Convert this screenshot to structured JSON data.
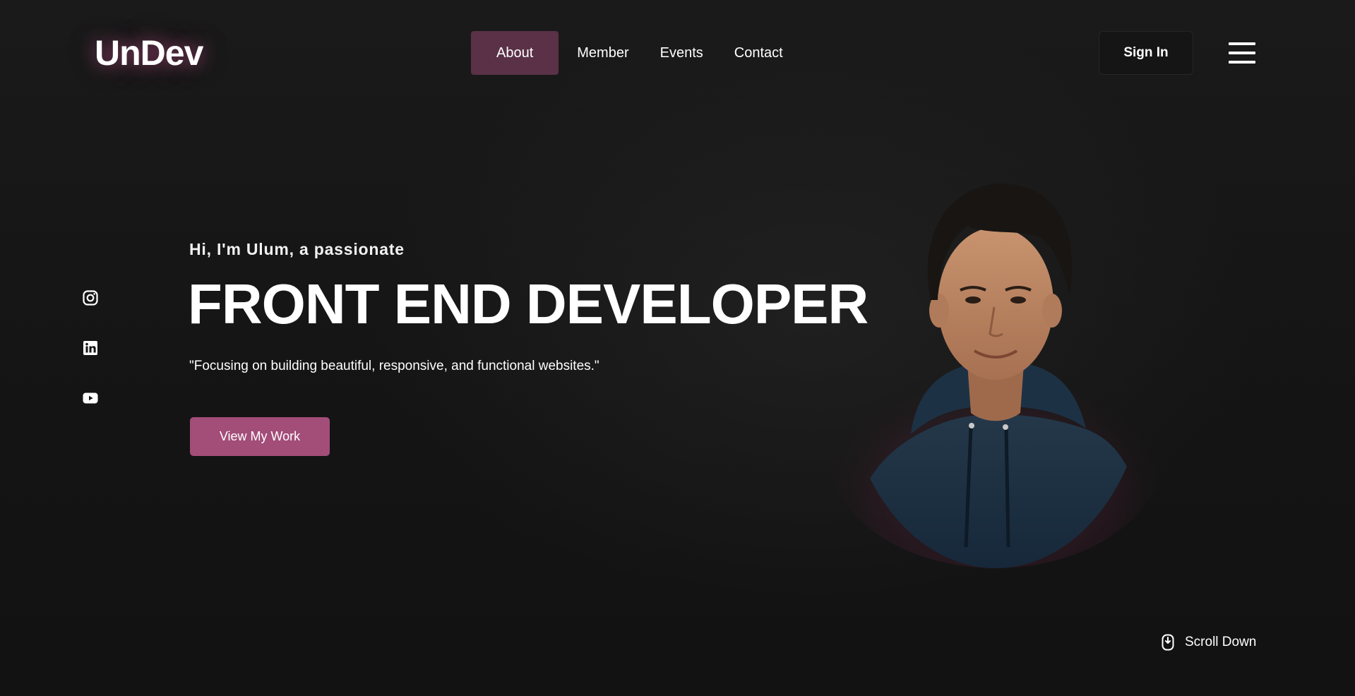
{
  "header": {
    "logo": "UnDev",
    "nav": [
      {
        "label": "About",
        "active": true
      },
      {
        "label": "Member",
        "active": false
      },
      {
        "label": "Events",
        "active": false
      },
      {
        "label": "Contact",
        "active": false
      }
    ],
    "sign_in_label": "Sign In",
    "menu_icon": "hamburger-menu-icon"
  },
  "social": {
    "icons": [
      "instagram-icon",
      "linkedin-icon",
      "youtube-icon"
    ]
  },
  "hero": {
    "greeting": "Hi, I'm Ulum, a passionate",
    "headline": "FRONT END DEVELOPER",
    "tagline": "\"Focusing on building beautiful, responsive, and functional websites.\"",
    "cta_label": "View My Work"
  },
  "scroll": {
    "label": "Scroll Down",
    "icon": "mouse-scroll-icon"
  },
  "colors": {
    "background": "#151515",
    "accent": "#a34d79",
    "nav_active": "#5a3147",
    "text": "#ffffff"
  }
}
